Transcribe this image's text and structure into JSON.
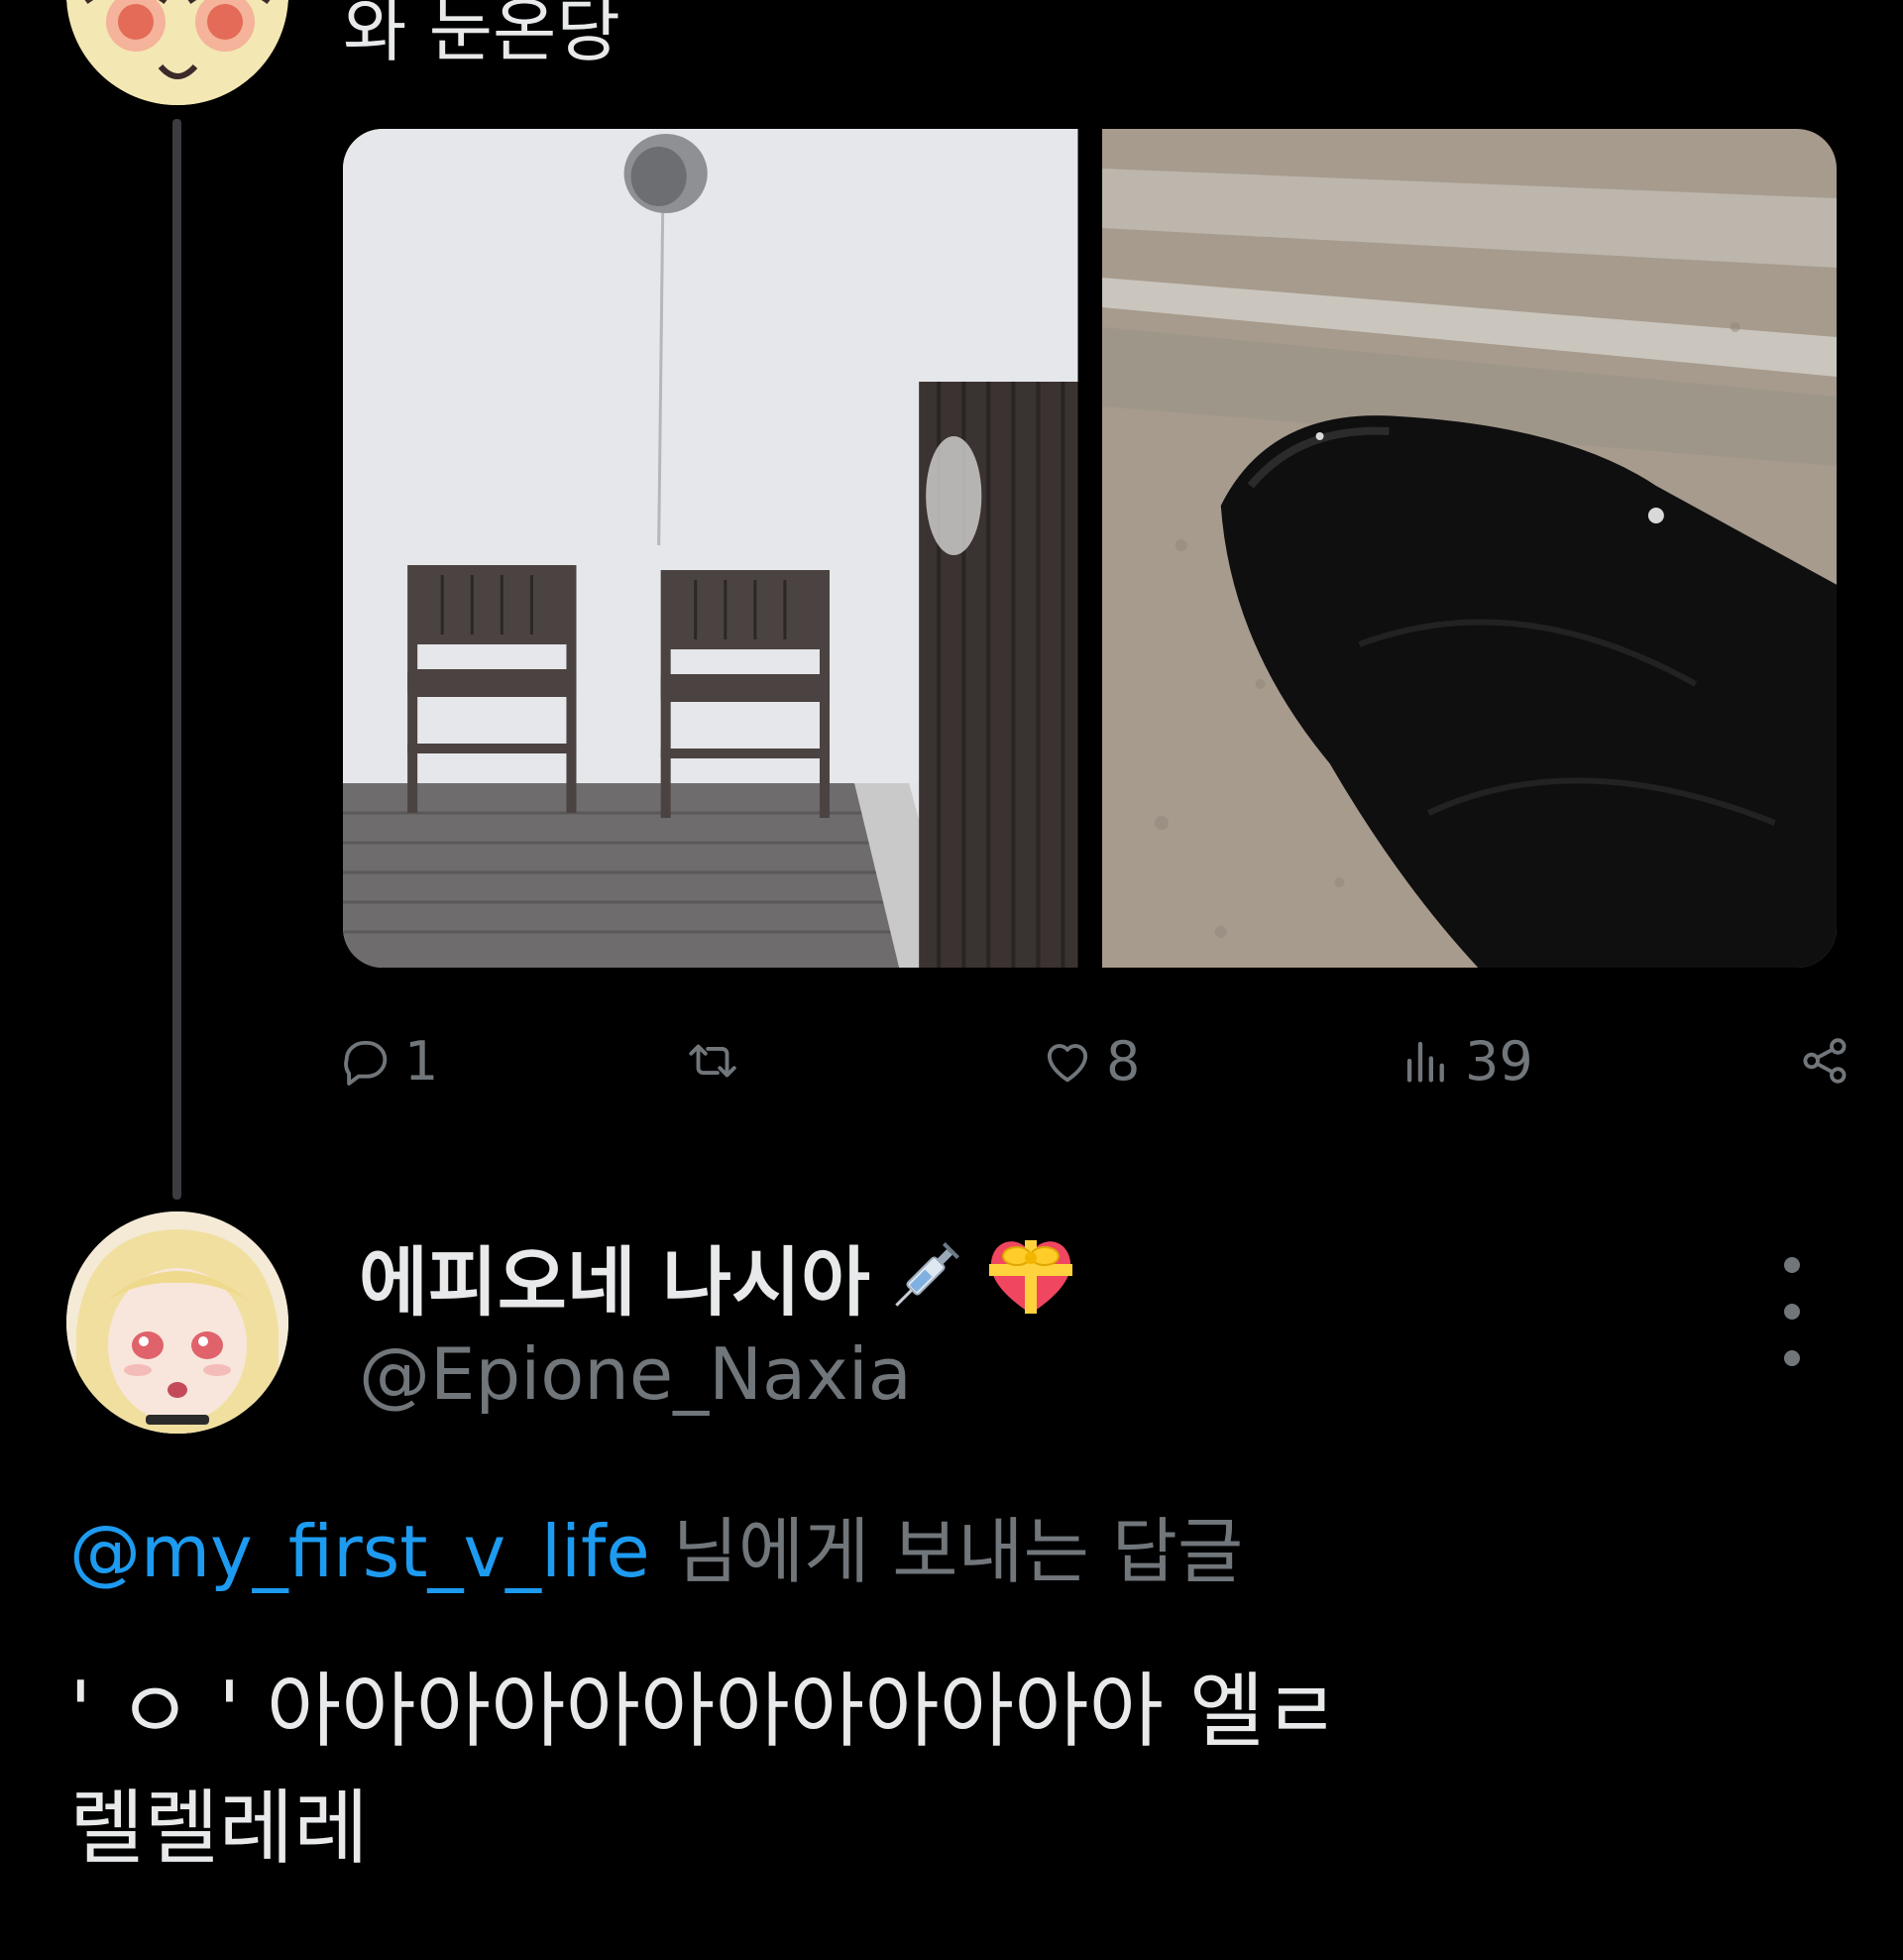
{
  "parent_tweet": {
    "text": "와 눈온당",
    "media": [
      {
        "icon": "photo-chairs"
      },
      {
        "icon": "photo-sleeve"
      }
    ],
    "actions": {
      "reply_count": "1",
      "retweet_count": "",
      "like_count": "8",
      "view_count": "39"
    }
  },
  "reply_tweet": {
    "display_name": "에피오네 나시아",
    "name_emojis": [
      "syringe-icon",
      "heart-with-ribbon-icon"
    ],
    "handle": "@Epione_Naxia",
    "replying_to_mention": "@my_first_v_life",
    "replying_to_suffix": " 님에게 보내는 답글",
    "body_lines": [
      "' ㅇ ' 아아아아아아아아아아아아 엘ㄹ",
      "렐렐레레"
    ]
  },
  "colors": {
    "background": "#000000",
    "text": "#e7e9ea",
    "secondary": "#71767b",
    "accent": "#1d9bf0",
    "thread_line": "#3b3d40"
  }
}
